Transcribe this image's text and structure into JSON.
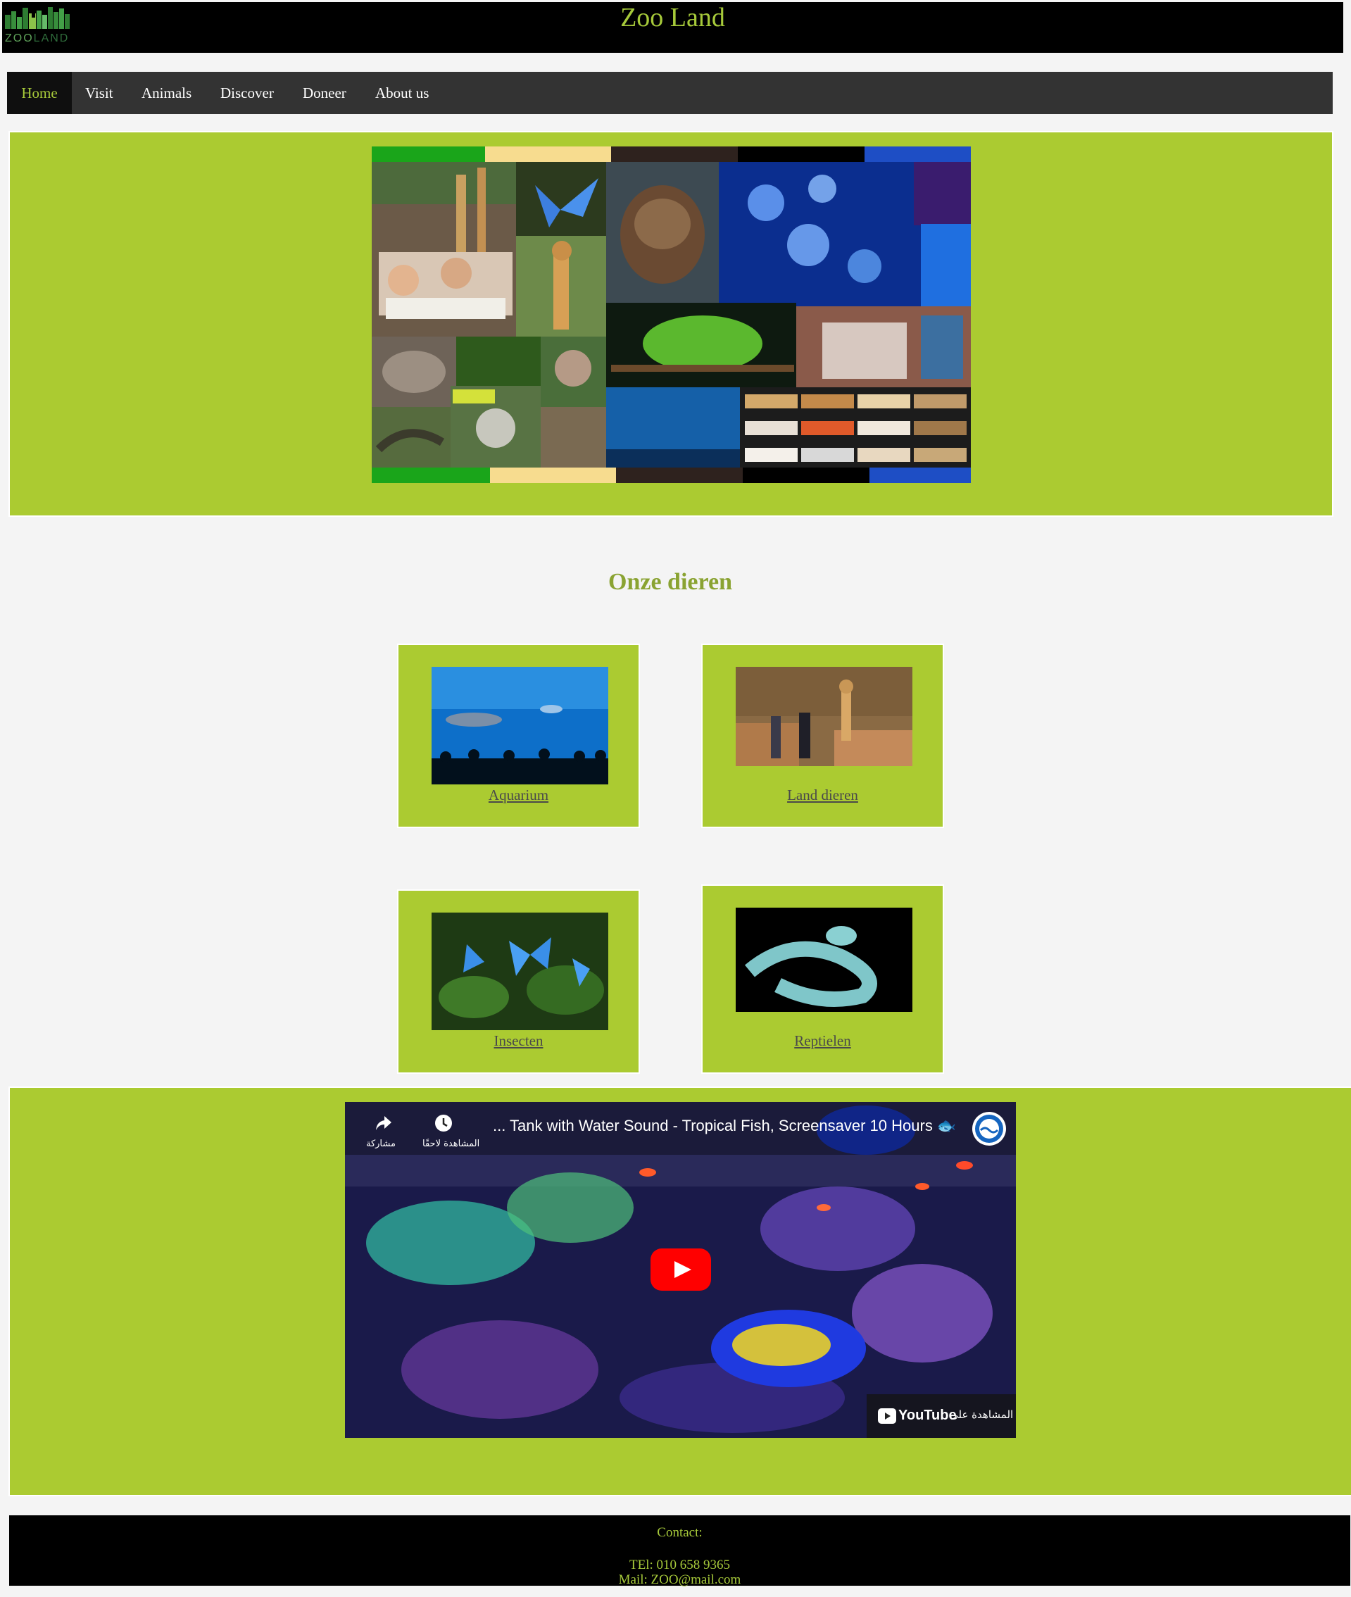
{
  "header": {
    "title": "Zoo Land",
    "logo": {
      "text_a": "ZOO",
      "text_b": "LAND"
    }
  },
  "nav": {
    "items": [
      {
        "label": "Home",
        "active": true
      },
      {
        "label": "Visit"
      },
      {
        "label": "Animals"
      },
      {
        "label": "Discover"
      },
      {
        "label": "Doneer"
      },
      {
        "label": "About us"
      }
    ]
  },
  "hero": {
    "image": "zoo-collage"
  },
  "animals": {
    "title": "Onze dieren",
    "cards": [
      {
        "label": "Aquarium",
        "image": "aquarium-photo"
      },
      {
        "label": "Land dieren",
        "image": "giraffe-photo"
      },
      {
        "label": "Insecten",
        "image": "butterflies-photo"
      },
      {
        "label": "Reptielen",
        "image": "snake-photo"
      }
    ]
  },
  "video": {
    "title": "... Tank with Water Sound - Tropical Fish, Screensaver 10 Hours 🐟",
    "share_label": "مشاركة",
    "watch_later_label": "المشاهدة لاحقًا",
    "watch_on_label": "المشاهدة على",
    "youtube_label": "YouTube"
  },
  "footer": {
    "contact": "Contact:",
    "tel": "TEl: 010 658 9365",
    "mail": "Mail: ZOO@mail.com"
  },
  "colors": {
    "accent": "#abcb31",
    "title_green": "#a6c93a",
    "dark": "#333333"
  }
}
